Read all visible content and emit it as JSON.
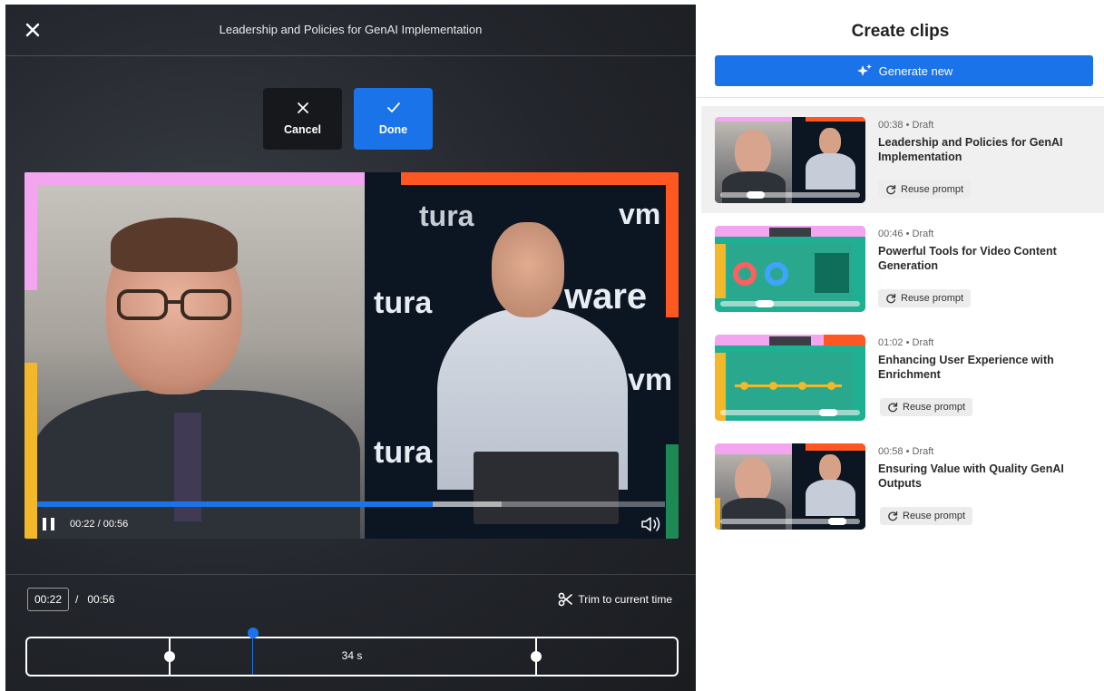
{
  "editor": {
    "title": "Leadership and Policies for GenAI Implementation",
    "cancel_label": "Cancel",
    "done_label": "Done",
    "player": {
      "time_display": "00:22 / 00:56",
      "played_fraction": 0.63,
      "buffered_fraction": 0.74,
      "video_brands": [
        "vm",
        "ware",
        "tura"
      ]
    },
    "timeline": {
      "current_time": "00:22",
      "separator": "/",
      "total_time": "00:56",
      "trim_label": "Trim to current time",
      "clip_duration": "34 s"
    }
  },
  "panel": {
    "title": "Create clips",
    "generate_label": "Generate new",
    "clips": [
      {
        "duration": "00:38",
        "status": "Draft",
        "title": "Leadership and Policies for GenAI Implementation",
        "reuse_label": "Reuse prompt"
      },
      {
        "duration": "00:46",
        "status": "Draft",
        "title": "Powerful Tools for Video Content Generation",
        "reuse_label": "Reuse prompt"
      },
      {
        "duration": "01:02",
        "status": "Draft",
        "title": "Enhancing User Experience with Enrichment",
        "reuse_label": "Reuse prompt"
      },
      {
        "duration": "00:58",
        "status": "Draft",
        "title": "Ensuring Value with Quality GenAI Outputs",
        "reuse_label": "Reuse prompt"
      }
    ]
  },
  "colors": {
    "accent": "#1a73e8",
    "brand_pink": "#f3a6ef",
    "brand_orange": "#ff5722",
    "brand_yellow": "#f2b829",
    "brand_green": "#1d8a55"
  },
  "icons": [
    "close-icon",
    "check-icon",
    "sparkle-icon",
    "pause-icon",
    "volume-icon",
    "scissors-icon",
    "refresh-icon"
  ]
}
